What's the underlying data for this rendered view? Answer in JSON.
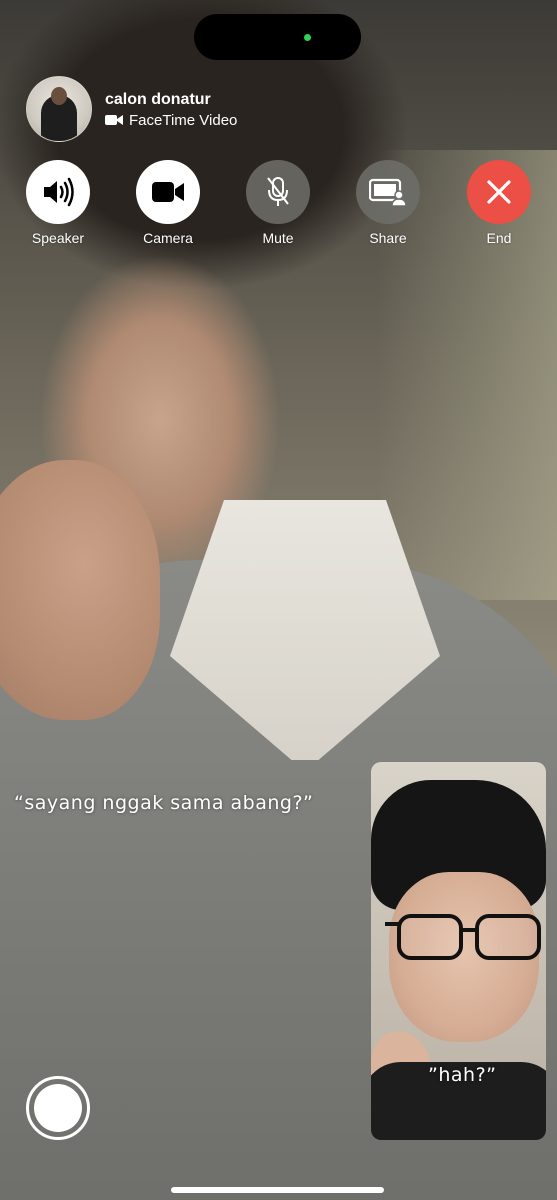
{
  "status": {
    "camera_indicator_color": "#30d158"
  },
  "call": {
    "name": "calon donatur",
    "subtitle": "FaceTime Video",
    "subtitle_icon": "video-camera-icon"
  },
  "controls": [
    {
      "id": "speaker",
      "label": "Speaker",
      "icon": "speaker-icon",
      "style": "white"
    },
    {
      "id": "camera",
      "label": "Camera",
      "icon": "video-camera-icon",
      "style": "white"
    },
    {
      "id": "mute",
      "label": "Mute",
      "icon": "mic-off-icon",
      "style": "gray"
    },
    {
      "id": "share",
      "label": "Share",
      "icon": "shareplay-icon",
      "style": "gray"
    },
    {
      "id": "end",
      "label": "End",
      "icon": "close-icon",
      "style": "red",
      "color": "#eb4f45"
    }
  ],
  "captions": {
    "remote": "“sayang nggak sama abang?”",
    "self": "”hah?”"
  }
}
